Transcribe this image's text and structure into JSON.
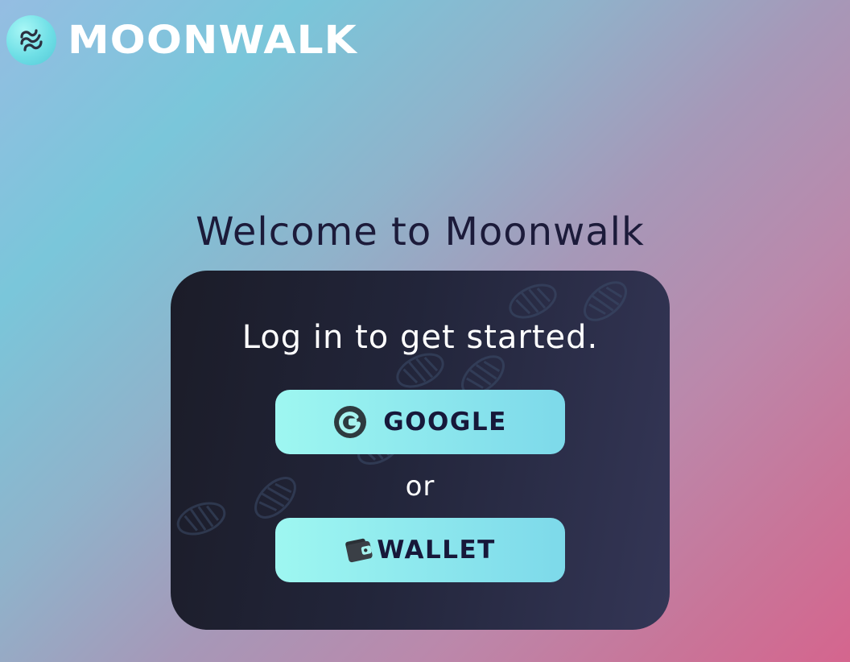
{
  "header": {
    "logo_icon": "moonwalk-logo-icon",
    "brand_name": "MOONWALK"
  },
  "main": {
    "welcome_title": "Welcome to Moonwalk",
    "card": {
      "subtitle": "Log in to get started.",
      "google_button": {
        "icon": "google-icon",
        "label": "GOOGLE"
      },
      "divider": "or",
      "wallet_button": {
        "icon": "wallet-icon",
        "label": "WALLET"
      },
      "decoration": "footprints-pattern"
    }
  },
  "colors": {
    "background_gradient": [
      "#95bde2",
      "#7ac6da",
      "#a698b8",
      "#d5658e"
    ],
    "card_background": [
      "#1b1c28",
      "#343656"
    ],
    "button_gradient": [
      "#9ef7f1",
      "#7dd9ea"
    ],
    "heading_text": "#1c1b3a",
    "button_text": "#17183a"
  }
}
